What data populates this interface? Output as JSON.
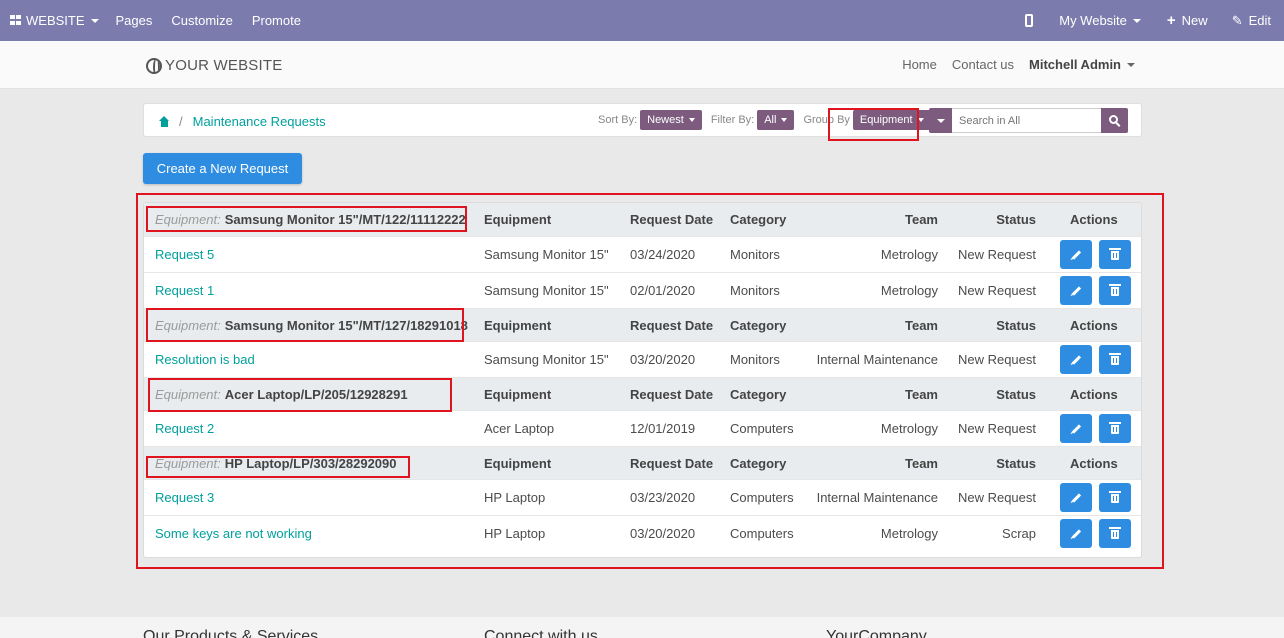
{
  "topbar": {
    "website_label": "WEBSITE",
    "pages": "Pages",
    "customize": "Customize",
    "promote": "Promote",
    "my_website": "My Website",
    "new": "New",
    "edit": "Edit"
  },
  "header": {
    "logo_text": "YOUR WEBSITE",
    "nav": [
      "Home",
      "Contact us"
    ],
    "user": "Mitchell Admin"
  },
  "breadcrumb": {
    "current": "Maintenance Requests",
    "separator": "/"
  },
  "filters": {
    "sort_label": "Sort By:",
    "sort_value": "Newest",
    "filter_label": "Filter By:",
    "filter_value": "All",
    "group_label": "Group By",
    "group_value": "Equipment",
    "search_placeholder": "Search in All"
  },
  "create_button": "Create a New Request",
  "table": {
    "columns": {
      "equipment": "Equipment",
      "request_date": "Request Date",
      "category": "Category",
      "team": "Team",
      "status": "Status",
      "actions": "Actions"
    },
    "group_prefix": "Equipment:",
    "groups": [
      {
        "name": "Samsung Monitor 15\"/MT/122/11112222",
        "rows": [
          {
            "name": "Request 5",
            "equipment": "Samsung Monitor 15\"",
            "date": "03/24/2020",
            "category": "Monitors",
            "team": "Metrology",
            "status": "New Request"
          },
          {
            "name": "Request 1",
            "equipment": "Samsung Monitor 15\"",
            "date": "02/01/2020",
            "category": "Monitors",
            "team": "Metrology",
            "status": "New Request"
          }
        ]
      },
      {
        "name": "Samsung Monitor 15\"/MT/127/18291018",
        "rows": [
          {
            "name": "Resolution is bad",
            "equipment": "Samsung Monitor 15\"",
            "date": "03/20/2020",
            "category": "Monitors",
            "team": "Internal Maintenance",
            "status": "New Request"
          }
        ]
      },
      {
        "name": "Acer Laptop/LP/205/12928291",
        "rows": [
          {
            "name": "Request 2",
            "equipment": "Acer Laptop",
            "date": "12/01/2019",
            "category": "Computers",
            "team": "Metrology",
            "status": "New Request"
          }
        ]
      },
      {
        "name": "HP Laptop/LP/303/28292090",
        "rows": [
          {
            "name": "Request 3",
            "equipment": "HP Laptop",
            "date": "03/23/2020",
            "category": "Computers",
            "team": "Internal Maintenance",
            "status": "New Request"
          },
          {
            "name": "Some keys are not working",
            "equipment": "HP Laptop",
            "date": "03/20/2020",
            "category": "Computers",
            "team": "Metrology",
            "status": "Scrap"
          }
        ]
      }
    ]
  },
  "footer": {
    "headings": [
      "Our Products & Services",
      "Connect with us",
      "YourCompany"
    ]
  },
  "colors": {
    "topbar": "#7c7bad",
    "accent": "#00a09d",
    "primary_button": "#2e8de1",
    "filter_button": "#7c5b7f",
    "highlight": "#e0141e"
  }
}
